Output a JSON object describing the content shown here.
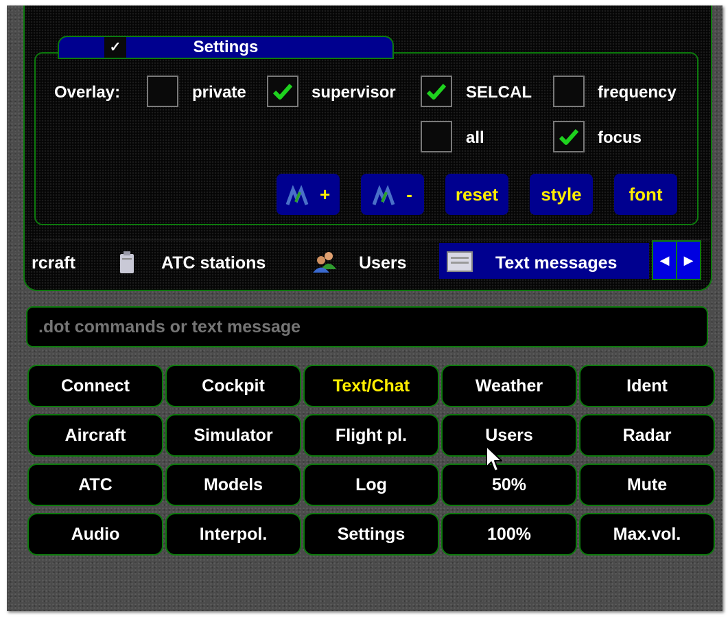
{
  "settings": {
    "check_mark": "✓",
    "title": "Settings",
    "overlay_label": "Overlay:",
    "options": [
      {
        "label": "private",
        "checked": false
      },
      {
        "label": "supervisor",
        "checked": true
      },
      {
        "label": "SELCAL",
        "checked": true
      },
      {
        "label": "frequency",
        "checked": false
      },
      {
        "label": "all",
        "checked": false
      },
      {
        "label": "focus",
        "checked": true
      }
    ],
    "buttons": {
      "zoom_in": "+",
      "zoom_out": "-",
      "reset": "reset",
      "style": "style",
      "font": "font"
    }
  },
  "tabs": [
    {
      "label": "rcraft",
      "icon": "aircraft-icon",
      "active": false
    },
    {
      "label": "ATC stations",
      "icon": "atc-station-icon",
      "active": false
    },
    {
      "label": "Users",
      "icon": "users-icon",
      "active": false
    },
    {
      "label": "Text messages",
      "icon": "text-messages-icon",
      "active": true
    }
  ],
  "tab_scroll": {
    "left": "◀",
    "right": "▶"
  },
  "command_input": {
    "placeholder": ".dot commands or text message",
    "value": ""
  },
  "grid": [
    [
      "Connect",
      "Cockpit",
      "Text/Chat",
      "Weather",
      "Ident"
    ],
    [
      "Aircraft",
      "Simulator",
      "Flight pl.",
      "Users",
      "Radar"
    ],
    [
      "ATC",
      "Models",
      "Log",
      "50%",
      "Mute"
    ],
    [
      "Audio",
      "Interpol.",
      "Settings",
      "100%",
      "Max.vol."
    ]
  ],
  "grid_active": "Text/Chat",
  "colors": {
    "accent_yellow": "#ffee00",
    "border_green": "#0c7a0c",
    "tab_blue": "#00008f",
    "check_green": "#1ed21e"
  }
}
